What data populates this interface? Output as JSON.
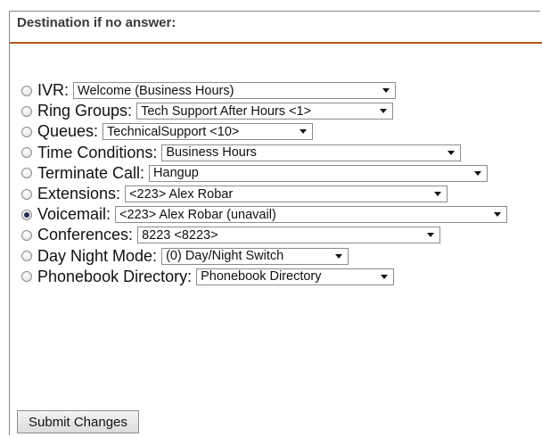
{
  "section": {
    "title": "Destination if no answer:"
  },
  "destinations": [
    {
      "label": "IVR:",
      "value": "Welcome (Business Hours)",
      "selected": false
    },
    {
      "label": "Ring Groups:",
      "value": "Tech Support After Hours <1>",
      "selected": false
    },
    {
      "label": "Queues:",
      "value": "TechnicalSupport <10>",
      "selected": false
    },
    {
      "label": "Time Conditions:",
      "value": "Business Hours",
      "selected": false
    },
    {
      "label": "Terminate Call:",
      "value": "Hangup",
      "selected": false
    },
    {
      "label": "Extensions:",
      "value": "<223> Alex Robar",
      "selected": false
    },
    {
      "label": "Voicemail:",
      "value": "<223> Alex Robar (unavail)",
      "selected": true
    },
    {
      "label": "Conferences:",
      "value": "8223 <8223>",
      "selected": false
    },
    {
      "label": "Day Night Mode:",
      "value": "(0) Day/Night Switch",
      "selected": false
    },
    {
      "label": "Phonebook Directory:",
      "value": "Phonebook Directory",
      "selected": false
    }
  ],
  "submit": {
    "label": "Submit Changes"
  },
  "colors": {
    "accent_rule": "#b4561c",
    "radio_dot": "#1c2f52"
  }
}
